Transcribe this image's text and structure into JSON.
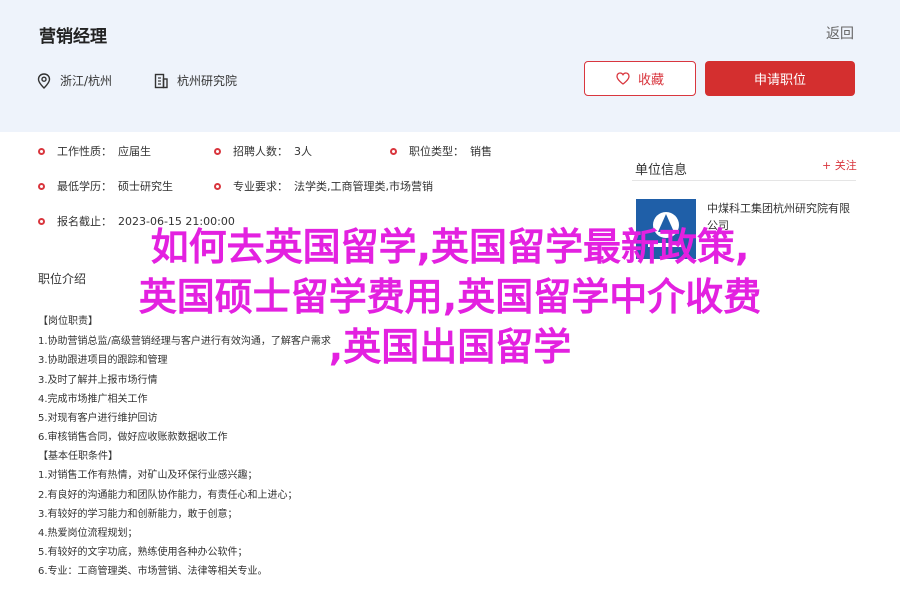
{
  "header": {
    "job_title": "营销经理",
    "back": "返回",
    "location": "浙江/杭州",
    "company": "杭州研究院",
    "favorite": "收藏",
    "apply": "申请职位"
  },
  "info": {
    "nature_label": "工作性质：",
    "nature": "应届生",
    "count_label": "招聘人数：",
    "count": "3人",
    "category_label": "职位类型：",
    "category": "销售",
    "edu_label": "最低学历：",
    "edu": "硕士研究生",
    "major_label": "专业要求：",
    "major": "法学类,工商管理类,市场营销",
    "deadline_label": "报名截止：",
    "deadline": "2023-06-15 21:00:00"
  },
  "unit": {
    "title": "单位信息",
    "follow": "+ 关注",
    "name": "中煤科工集团杭州研究院有限公司"
  },
  "description": {
    "title": "职位介绍",
    "section1": "【岗位职责】",
    "duties": [
      "1.协助营销总监/高级营销经理与客户进行有效沟通，了解客户需求",
      "3.协助跟进项目的跟踪和管理",
      "3.及时了解并上报市场行情",
      "4.完成市场推广相关工作",
      "5.对现有客户进行维护回访",
      "6.审核销售合同，做好应收账款数据收工作"
    ],
    "section2": "【基本任职条件】",
    "requirements": [
      "1.对销售工作有热情，对矿山及环保行业感兴趣；",
      "2.有良好的沟通能力和团队协作能力，有责任心和上进心；",
      "3.有较好的学习能力和创新能力，敢于创意；",
      "4.热爱岗位流程规划；",
      "5.有较好的文字功底，熟练使用各种办公软件；",
      "6.专业：工商管理类、市场营销、法律等相关专业。"
    ]
  },
  "overlay": {
    "line1": "如何去英国留学,英国留学最新政策,",
    "line2": "英国硕士留学费用,英国留学中介收费",
    "line3": ",英国出国留学"
  },
  "colors": {
    "accent": "#d42f2f",
    "header_bg": "#eef3fb",
    "overlay": "#e321e0"
  }
}
